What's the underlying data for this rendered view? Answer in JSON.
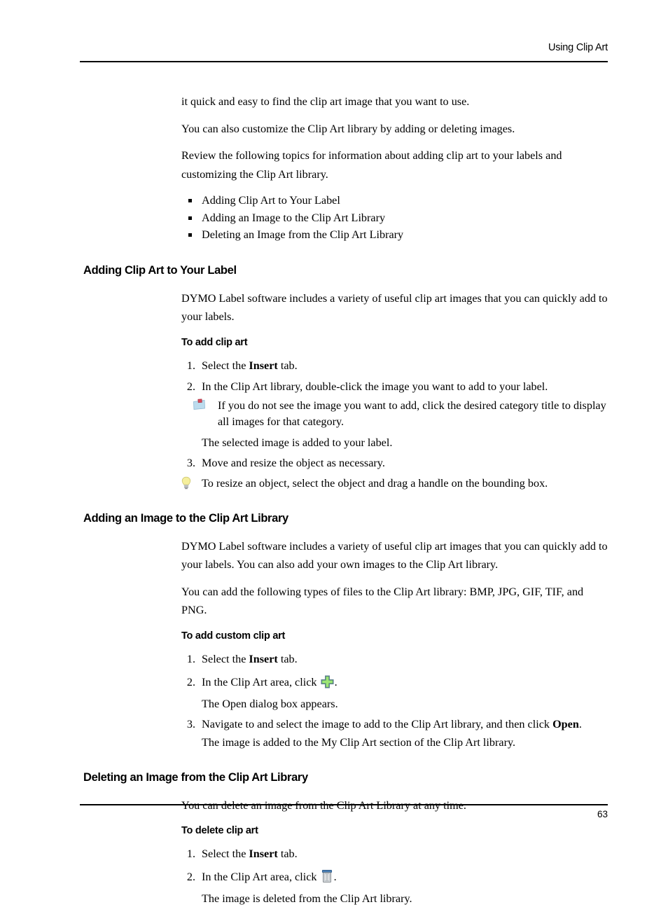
{
  "header": {
    "running_title": "Using Clip Art"
  },
  "footer": {
    "page_number": "63"
  },
  "intro": {
    "p1": "it quick and easy to find the clip art image that you want to use.",
    "p2": "You can also customize the Clip Art library by adding or deleting images.",
    "p3": "Review the following topics for information about adding clip art to your labels and customizing the Clip Art library.",
    "topics": [
      "Adding Clip Art to Your Label",
      "Adding an Image to the Clip Art Library",
      "Deleting an Image from the Clip Art Library"
    ]
  },
  "sections": [
    {
      "heading": "Adding Clip Art to Your Label",
      "intro": "DYMO Label software includes a variety of useful clip art images that you can quickly add to your labels.",
      "proc_heading": "To add clip art",
      "step1_pre": "Select the ",
      "step1_bold": "Insert",
      "step1_post": " tab.",
      "step1_num": "1.",
      "step2_num": "2.",
      "step2_text": "In the Clip Art library, double-click the image you want to add to your label.",
      "note_text": "If you do not see the image you want to add, click the desired category title to display all images for that category.",
      "note_icon": "note-icon",
      "step2_result": "The selected image is added to your label.",
      "step3_num": "3.",
      "step3_text": "Move and resize the object as necessary.",
      "tip_icon": "lightbulb-icon",
      "tip_text": "To resize an object, select the object and drag a handle on the bounding box."
    },
    {
      "heading": "Adding an Image to the Clip Art Library",
      "intro": "DYMO Label software includes a variety of useful clip art images that you can quickly add to your labels. You can also add your own images to the Clip Art library.",
      "formats": "You can add the following types of files to the Clip Art library: BMP, JPG, GIF, TIF, and PNG.",
      "proc_heading": "To add custom clip art",
      "step1_num": "1.",
      "step1_pre": "Select the ",
      "step1_bold": "Insert",
      "step1_post": " tab.",
      "step2_num": "2.",
      "step2_pre": "In the Clip Art area, click ",
      "step2_icon": "add-plus-icon",
      "step2_post": ".",
      "step2_result": "The Open dialog box appears.",
      "step3_num": "3.",
      "step3_pre": "Navigate to and select the image to add to the Clip Art library, and then click ",
      "step3_bold": "Open",
      "step3_post": ".",
      "step3_result": "The image is added to the My Clip Art section of the Clip Art library."
    },
    {
      "heading": "Deleting an Image from the Clip Art Library",
      "intro": "You can delete an image from the Clip Art Library at any time.",
      "proc_heading": "To delete clip art",
      "step1_num": "1.",
      "step1_pre": "Select the ",
      "step1_bold": "Insert",
      "step1_post": " tab.",
      "step2_num": "2.",
      "step2_pre": "In the Clip Art area, click ",
      "step2_icon": "delete-trash-icon",
      "step2_post": ".",
      "step2_result": "The image is deleted from the Clip Art library."
    }
  ],
  "colors": {
    "text": "#000000",
    "rule": "#000000",
    "note_card": "#bcdcee",
    "note_pin": "#d94a5a",
    "tip_bulb": "#f5ef9c",
    "plus_green": "#7ed957",
    "plus_border": "#5b7f8c",
    "trash_lid": "#4a7fb5",
    "trash_body": "#d8dce0"
  }
}
